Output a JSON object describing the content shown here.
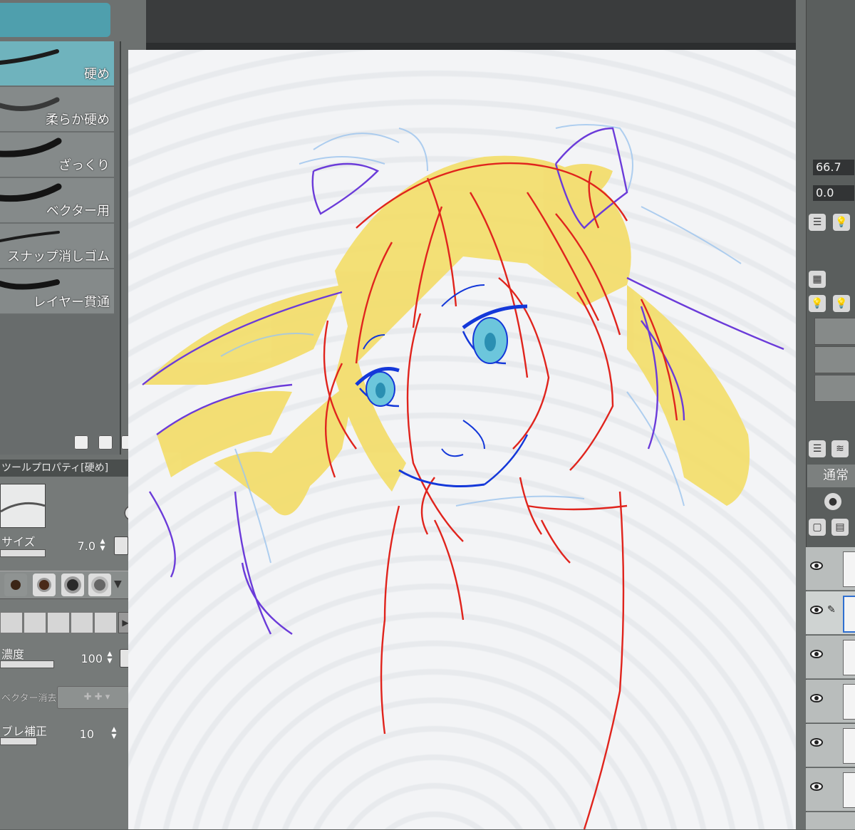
{
  "brush_panel": {
    "items": [
      {
        "label": "硬め",
        "selected": true
      },
      {
        "label": "柔らか硬め",
        "selected": false
      },
      {
        "label": "ざっくり",
        "selected": false
      },
      {
        "label": "ベクター用",
        "selected": false
      },
      {
        "label": "スナップ消しゴム",
        "selected": false
      },
      {
        "label": "レイヤー貫通",
        "selected": false
      }
    ]
  },
  "tool_property": {
    "title": "ツールプロパティ[硬め]",
    "size_label": "サイズ",
    "size_value": "7.0",
    "density_label": "濃度",
    "density_value": "100",
    "vector_erase_label": "ベクター消去",
    "stabilization_label": "ブレ補正",
    "stabilization_value": "10"
  },
  "navigator": {
    "zoom_value": "66.7",
    "rotation_value": "0.0"
  },
  "layer_panel": {
    "blend_mode": "通常",
    "layers": [
      {
        "visible": true
      },
      {
        "visible": true,
        "active": true
      },
      {
        "visible": true
      },
      {
        "visible": true
      },
      {
        "visible": true
      },
      {
        "visible": true
      },
      {
        "visible": true
      }
    ]
  },
  "colors": {
    "selected_brush": "#6fb3bd",
    "hair_fill": "#f3dd6a",
    "line_red": "#e0241d",
    "line_blue": "#1438d9",
    "line_purple": "#6b3bd9",
    "sketch_lightblue": "#9cc4ee",
    "eye_fill": "#6cc6dc"
  }
}
